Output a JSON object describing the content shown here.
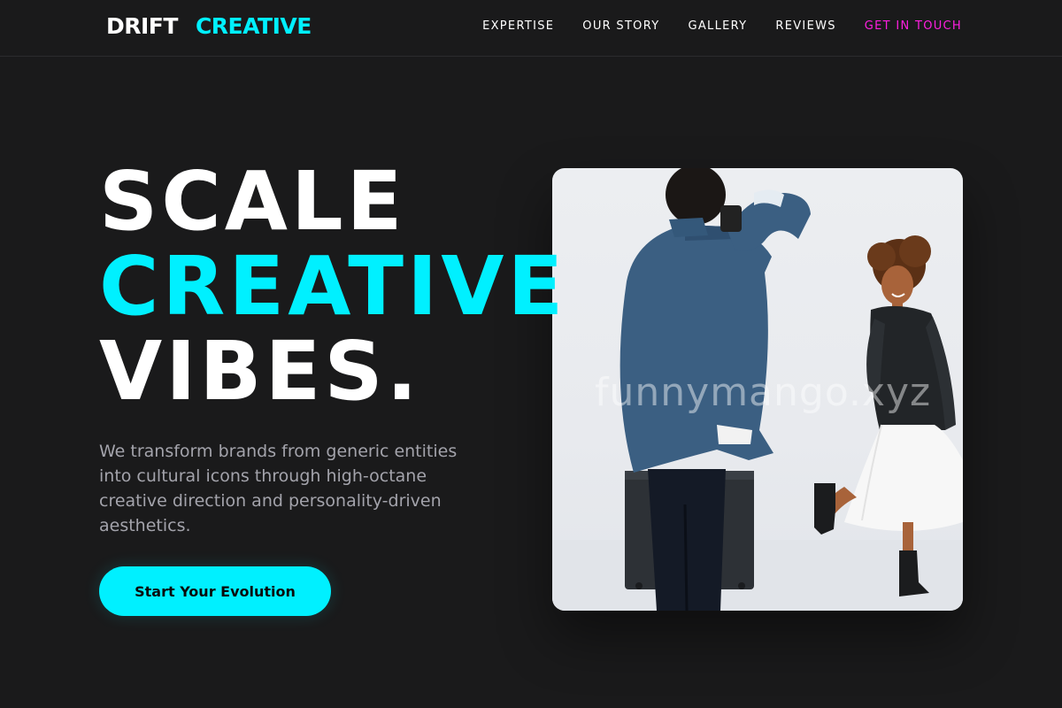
{
  "brand": {
    "word1": "DRIFT",
    "word2": "CREATIVE"
  },
  "nav": {
    "items": [
      "EXPERTISE",
      "OUR STORY",
      "GALLERY",
      "REVIEWS"
    ],
    "cta": "GET IN TOUCH"
  },
  "hero": {
    "line1": "SCALE",
    "line2": "CREATIVE",
    "line3": "VIBES.",
    "subtitle": "We transform brands from generic entities into cultural icons through high-octane creative direction and personality-driven aesthetics.",
    "button": "Start Your Evolution"
  },
  "image": {
    "watermark": "funnymango.xyz"
  },
  "colors": {
    "background": "#1a1a1b",
    "accent_cyan": "#00f0ff",
    "accent_magenta": "#ff1fe0",
    "text_muted": "#a3a3ab"
  }
}
